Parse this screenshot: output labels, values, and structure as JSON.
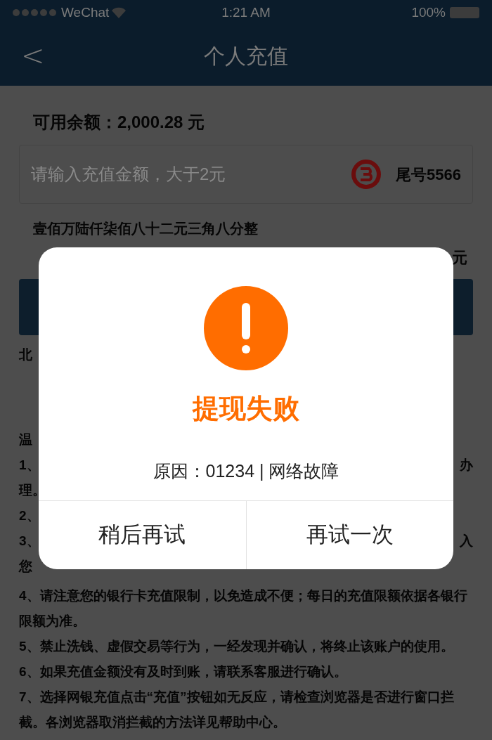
{
  "status_bar": {
    "carrier": "WeChat",
    "time": "1:21 AM",
    "battery": "100%"
  },
  "nav": {
    "back": "<",
    "title": "个人充值"
  },
  "balance": "可用余额：2,000.28 元",
  "amount_field": {
    "placeholder": "请输入充值金额，大于2元",
    "card": "尾号5566"
  },
  "amount_words": "壹佰万陆仟柒佰八十二元三角八分整",
  "after_balance_right": "元",
  "bank_line_left": "北",
  "notes_title_left": "温",
  "notes_hidden": [
    {
      "left": "1、",
      "right": "办"
    },
    {
      "left": "理。"
    },
    {
      "left": "2、"
    },
    {
      "left": "3、",
      "right": "入"
    },
    {
      "left": "您"
    }
  ],
  "notes": [
    "4、请注意您的银行卡充值限制，以免造成不便；每日的充值限额依据各银行限额为准。",
    "5、禁止洗钱、虚假交易等行为，一经发现并确认，将终止该账户的使用。",
    "6、如果充值金额没有及时到账，请联系客服进行确认。",
    "7、选择网银充值点击“充值”按钮如无反应，请检查浏览器是否进行窗口拦截。各浏览器取消拦截的方法详见帮助中心。"
  ],
  "dialog": {
    "title": "提现失败",
    "reason": "原因：01234 | 网络故障",
    "buttons": [
      "稍后再试",
      "再试一次"
    ]
  }
}
